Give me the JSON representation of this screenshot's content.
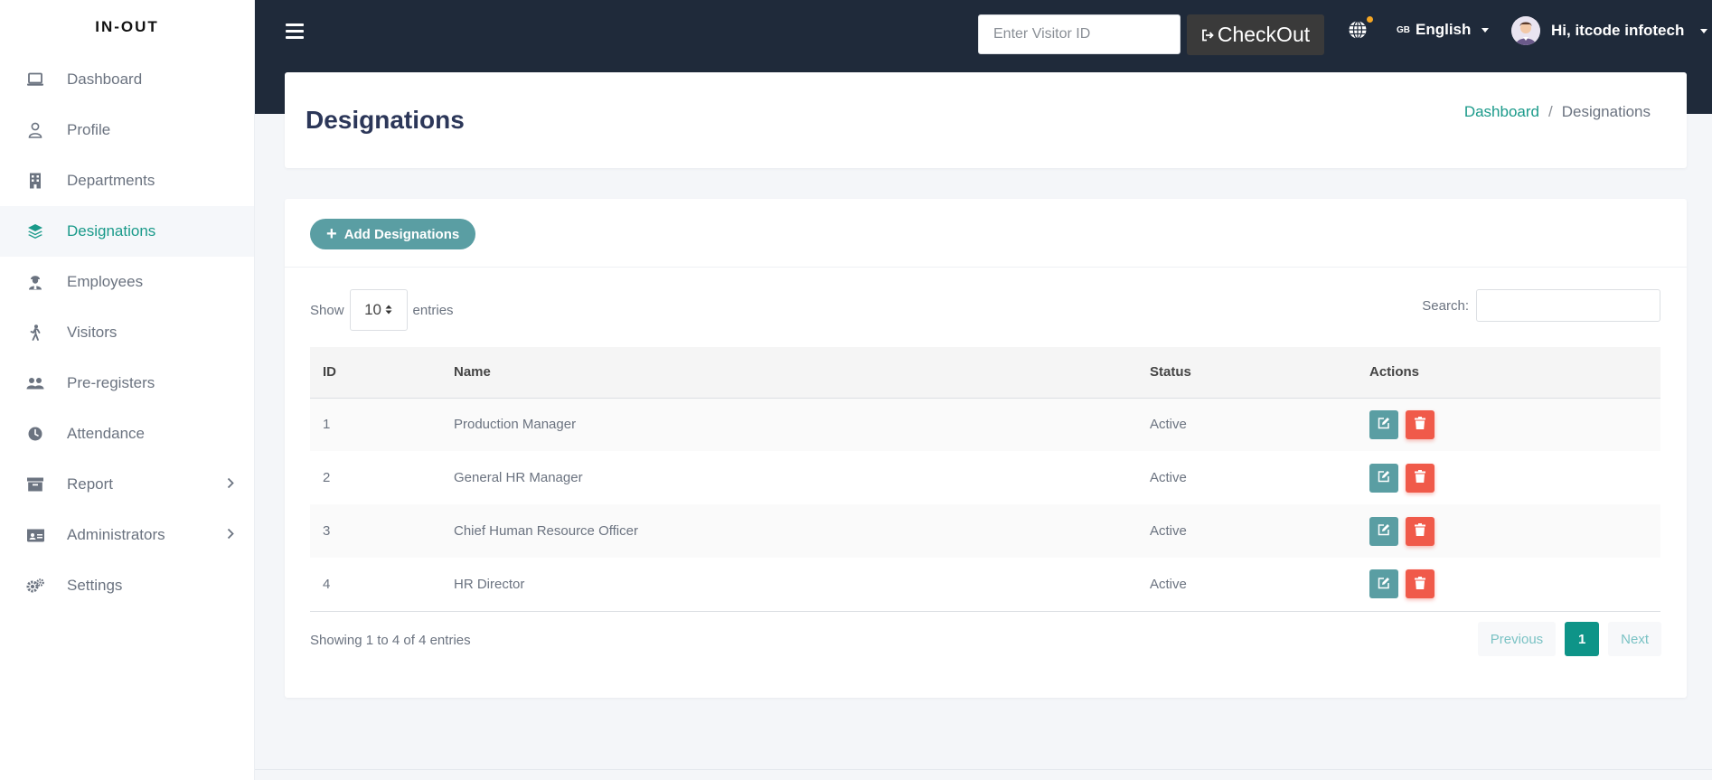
{
  "brand": "IN-OUT",
  "sidebar": {
    "items": [
      {
        "label": "Dashboard",
        "icon": "laptop-icon"
      },
      {
        "label": "Profile",
        "icon": "user-icon"
      },
      {
        "label": "Departments",
        "icon": "building-icon"
      },
      {
        "label": "Designations",
        "icon": "layers-icon",
        "active": true
      },
      {
        "label": "Employees",
        "icon": "user-tie-icon"
      },
      {
        "label": "Visitors",
        "icon": "walking-icon"
      },
      {
        "label": "Pre-registers",
        "icon": "users-icon"
      },
      {
        "label": "Attendance",
        "icon": "clock-icon"
      },
      {
        "label": "Report",
        "icon": "archive-icon",
        "has_children": true
      },
      {
        "label": "Administrators",
        "icon": "id-card-icon",
        "has_children": true
      },
      {
        "label": "Settings",
        "icon": "gears-icon"
      }
    ]
  },
  "header": {
    "visitor_placeholder": "Enter Visitor ID",
    "checkout_label": "CheckOut",
    "language_flag": "GB",
    "language": "English",
    "user_greeting": "Hi, itcode infotech"
  },
  "page": {
    "title": "Designations",
    "breadcrumb": {
      "home": "Dashboard",
      "sep": "/",
      "current": "Designations"
    }
  },
  "card": {
    "add_label": "Add Designations",
    "show_label": "Show",
    "entries_value": "10",
    "entries_label": "entries",
    "search_label": "Search:"
  },
  "table": {
    "columns": [
      "ID",
      "Name",
      "Status",
      "Actions"
    ],
    "rows": [
      {
        "id": "1",
        "name": "Production Manager",
        "status": "Active"
      },
      {
        "id": "2",
        "name": "General HR Manager",
        "status": "Active"
      },
      {
        "id": "3",
        "name": "Chief Human Resource Officer",
        "status": "Active"
      },
      {
        "id": "4",
        "name": "HR Director",
        "status": "Active"
      }
    ]
  },
  "footer": {
    "info": "Showing 1 to 4 of 4 entries",
    "previous": "Previous",
    "page": "1",
    "next": "Next"
  },
  "colors": {
    "accent": "#1a9a8a",
    "topbar": "#1f2a3a",
    "edit": "#5a9ea3",
    "delete": "#f05a4a",
    "page_active": "#0e9488"
  }
}
